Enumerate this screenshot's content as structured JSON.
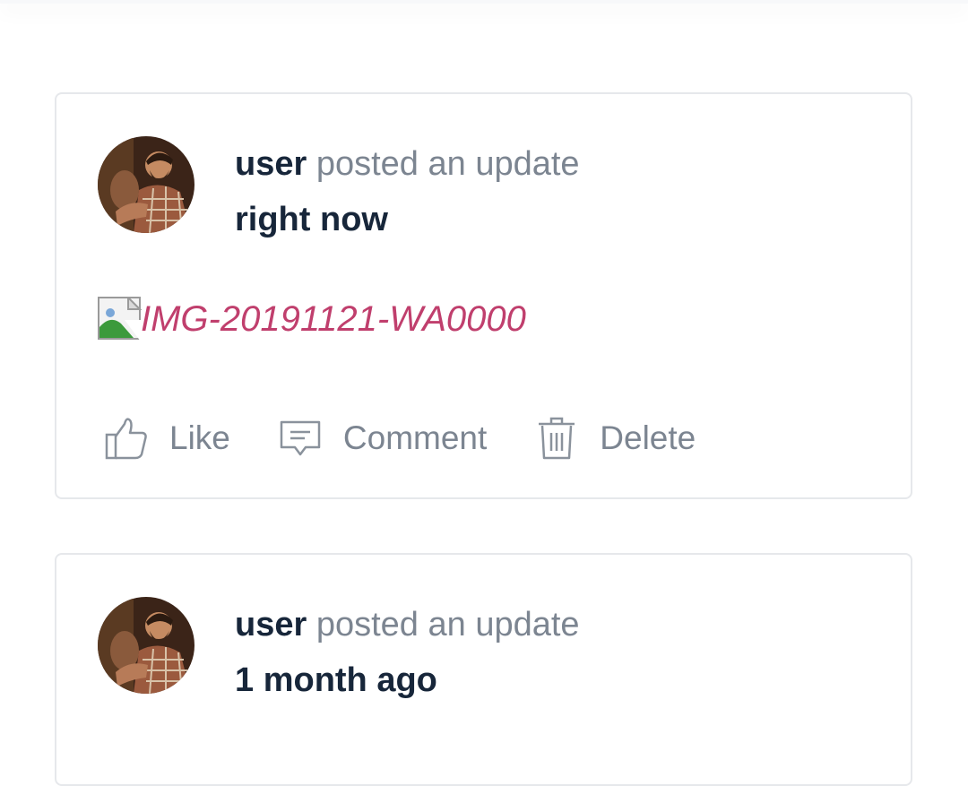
{
  "posts": [
    {
      "author": "user",
      "action_text": " posted an update",
      "time": "right now",
      "attachment": {
        "alt_text": "IMG-20191121-WA0000"
      },
      "actions": {
        "like": "Like",
        "comment": "Comment",
        "delete": "Delete"
      }
    },
    {
      "author": "user",
      "action_text": " posted an update",
      "time": "1 month ago"
    }
  ],
  "colors": {
    "text_dark": "#17263a",
    "text_muted": "#7c8591",
    "link": "#c03f6d",
    "border": "#e6e8eb"
  },
  "icons": [
    "thumbs-up-icon",
    "comment-icon",
    "trash-icon",
    "broken-image-icon"
  ]
}
